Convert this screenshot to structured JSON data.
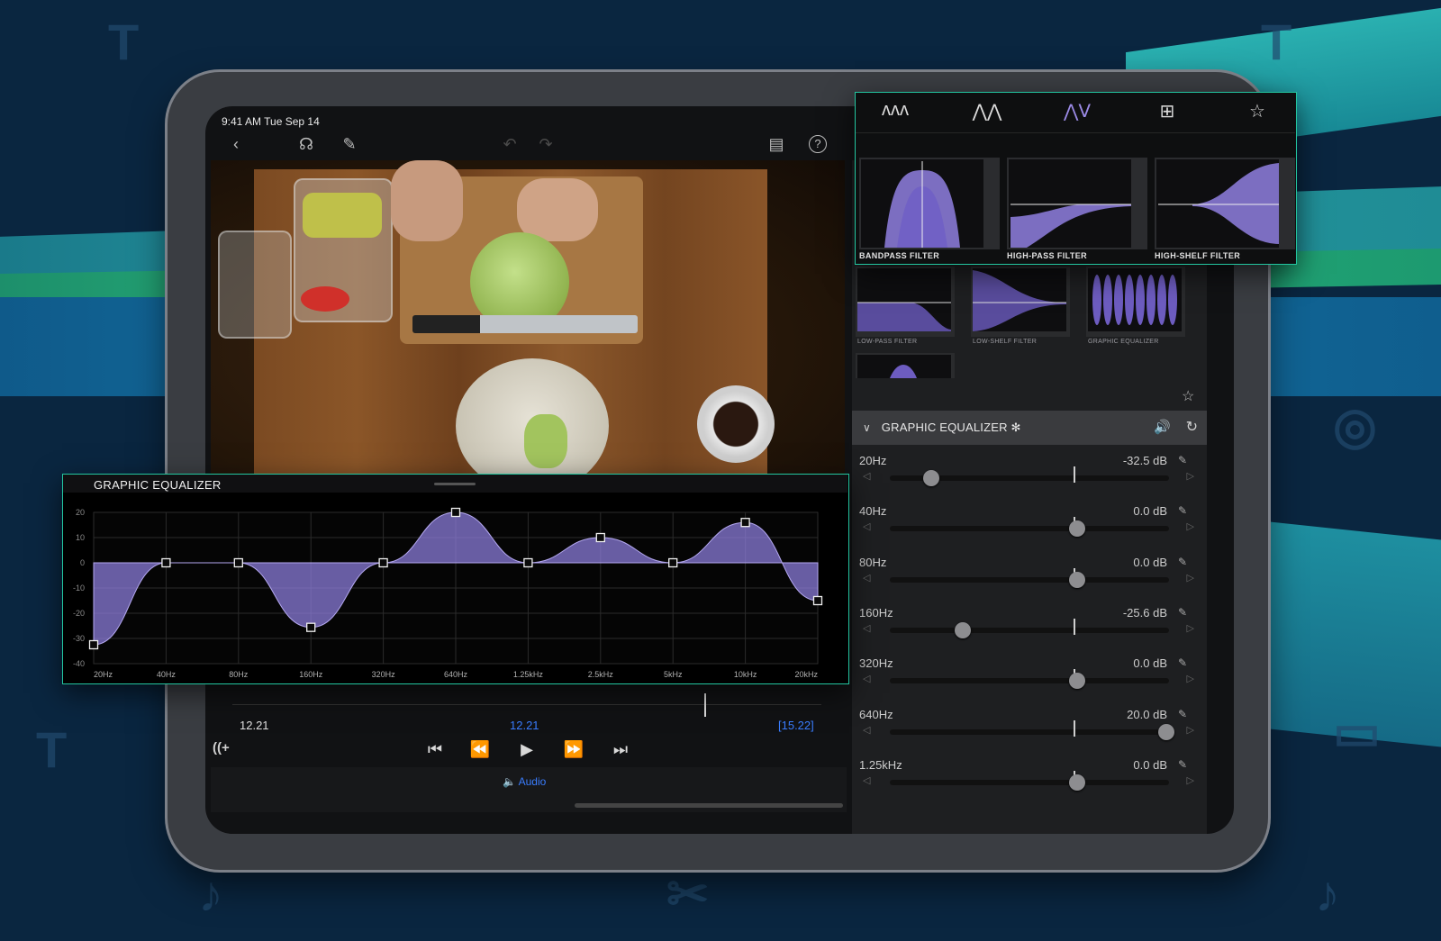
{
  "status_bar": {
    "time": "9:41 AM   Tue Sep 14"
  },
  "toolbar": {
    "icons": [
      "back-chevron-icon",
      "headphones-icon",
      "voiceover-icon",
      "undo-icon",
      "redo-icon",
      "clipboard-icon",
      "help-icon"
    ],
    "back_glyph": "‹",
    "headphones_glyph": "☊",
    "voiceover_glyph": "✎",
    "undo_glyph": "↶",
    "redo_glyph": "↷",
    "clipboard_glyph": "▤",
    "help_glyph": "?"
  },
  "filter_tabs": {
    "glyphs": [
      "ʌʌʌ",
      "⋀⋀",
      "⋀ᐯ",
      "⊞",
      "☆"
    ],
    "active_index": 2
  },
  "filter_cards": [
    {
      "label": "BANDPASS FILTER"
    },
    {
      "label": "HIGH-PASS FILTER"
    },
    {
      "label": "HIGH-SHELF FILTER"
    }
  ],
  "effects_rack": [
    {
      "label": "LOW-PASS FILTER"
    },
    {
      "label": "LOW-SHELF FILTER"
    },
    {
      "label": "GRAPHIC EQUALIZER"
    }
  ],
  "inspector": {
    "favorite_glyph": "☆",
    "eq_header": {
      "chevron": "∨",
      "title": "GRAPHIC EQUALIZER ✻",
      "speaker": "🔊",
      "reset": "↻"
    },
    "bands": [
      {
        "name": "20Hz",
        "value": "-32.5 dB",
        "db": -32.5
      },
      {
        "name": "40Hz",
        "value": "0.0 dB",
        "db": 0
      },
      {
        "name": "80Hz",
        "value": "0.0 dB",
        "db": 0
      },
      {
        "name": "160Hz",
        "value": "-25.6 dB",
        "db": -25.6
      },
      {
        "name": "320Hz",
        "value": "0.0 dB",
        "db": 0
      },
      {
        "name": "640Hz",
        "value": "20.0 dB",
        "db": 20
      },
      {
        "name": "1.25kHz",
        "value": "0.0 dB",
        "db": 0
      }
    ],
    "band_minus": "◁",
    "band_plus": "▷",
    "band_pencil": "✎",
    "db_range": [
      -40,
      20
    ]
  },
  "eq_panel": {
    "title": "GRAPHIC EQUALIZER",
    "y_ticks": [
      "20",
      "10",
      "0",
      "-10",
      "-20",
      "-30",
      "-40"
    ],
    "x_ticks": [
      "20Hz",
      "40Hz",
      "80Hz",
      "160Hz",
      "320Hz",
      "640Hz",
      "1.25kHz",
      "2.5kHz",
      "5kHz",
      "10kHz",
      "20kHz"
    ],
    "node_db": [
      -32.5,
      0,
      0,
      -25.6,
      0,
      20,
      0,
      10,
      0,
      16,
      -15
    ],
    "ylim": [
      -40,
      20
    ]
  },
  "timeline": {
    "position": "12.21",
    "current": "12.21",
    "duration": "[15.22]",
    "add_glyph": "((+",
    "transport": [
      "⏮",
      "⏪",
      "▶",
      "⏩",
      "⏭"
    ]
  },
  "tab_bar": {
    "audio_label": "🔈  Audio"
  },
  "colors": {
    "accent_purple": "#8f7fe0",
    "callout_border": "#23c6a0",
    "timecode_blue": "#3a7dff"
  }
}
